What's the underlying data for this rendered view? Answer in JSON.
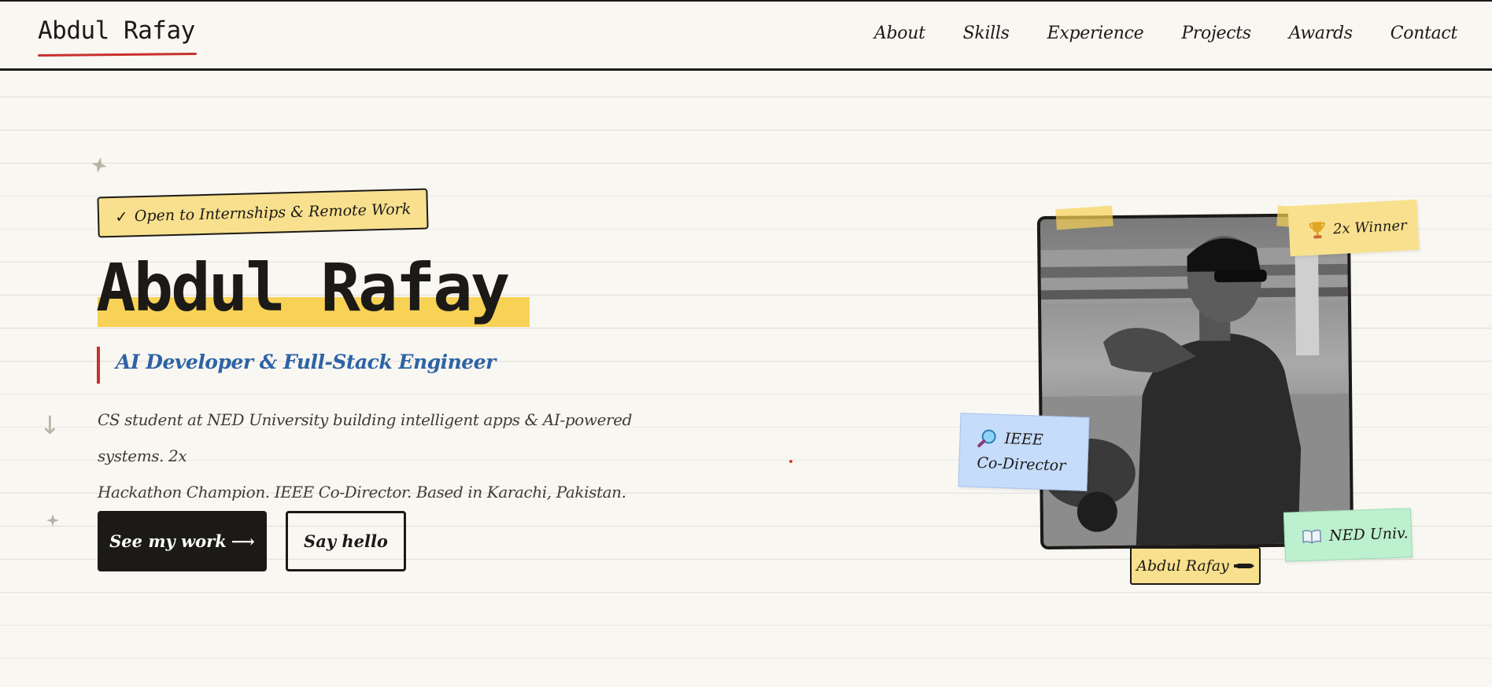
{
  "header": {
    "logo": "Abdul Rafay",
    "nav": [
      "About",
      "Skills",
      "Experience",
      "Projects",
      "Awards",
      "Contact"
    ]
  },
  "hero": {
    "badge_check": "✓",
    "badge": "Open to Internships & Remote Work",
    "name": "Abdul Rafay",
    "role": "AI Developer & Full-Stack Engineer",
    "bio_line1": "CS student at NED University building intelligent apps & AI-powered systems. 2x",
    "bio_line2": "Hackathon Champion. IEEE Co-Director. Based in Karachi, Pakistan.",
    "cta_primary": "See my work",
    "cta_primary_arrow": "⟶",
    "cta_secondary": "Say hello"
  },
  "photo": {
    "name_tag": "Abdul Rafay"
  },
  "stickies": {
    "winner": "2x Winner",
    "ieee_line1": "IEEE",
    "ieee_line2": "Co-Director",
    "ned": "NED Univ."
  },
  "icons": {
    "trophy": "trophy-icon",
    "magnifier": "magnifier-icon",
    "book": "open-book-icon",
    "pen": "pen-icon",
    "scroll": "arrow-down-icon",
    "sparkle": "sparkle-icon"
  },
  "colors": {
    "ink": "#1c1a17",
    "paper": "#f9f7f2",
    "highlight": "#f8d256",
    "accent_red": "#c9302c",
    "accent_blue": "#2d63a6",
    "sticky_yellow": "#f8e08e",
    "sticky_blue": "#c5dcfb",
    "sticky_green": "#bdf0cf"
  }
}
